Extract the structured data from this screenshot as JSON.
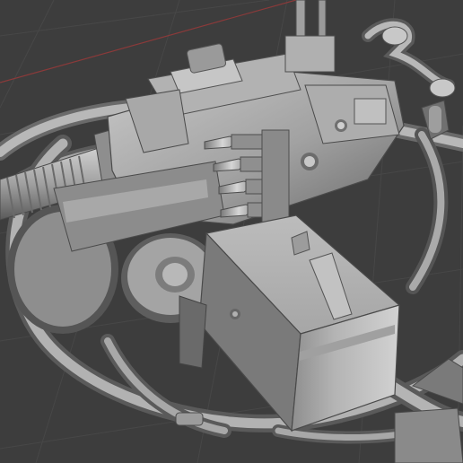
{
  "viewport": {
    "background_color": "#3d3d3d",
    "grid_line_color": "#474747",
    "axis_x_color": "#8a3a3a",
    "model_base_color": "#9a9a9a",
    "model_light_color": "#c4c4c4",
    "model_shadow_color": "#5e5e5e"
  },
  "model": {
    "parts": [
      "ring-mount",
      "machine-gun",
      "barrel-jacket",
      "ammo-belt",
      "ammo-box",
      "pintle-handle",
      "sight-post"
    ]
  }
}
